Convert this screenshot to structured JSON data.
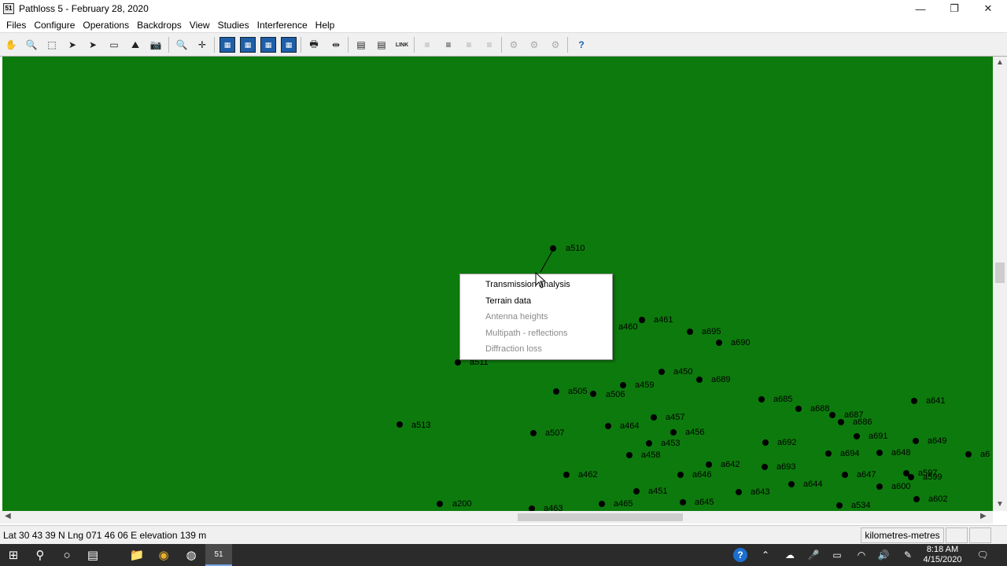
{
  "window": {
    "title": "Pathloss 5 - February 28, 2020",
    "app_icon_text": "51",
    "minimize": "—",
    "restore": "❐",
    "close": "✕"
  },
  "menu": [
    "Files",
    "Configure",
    "Operations",
    "Backdrops",
    "View",
    "Studies",
    "Interference",
    "Help"
  ],
  "toolbar": {
    "pan": "✋",
    "zoom": "🔍",
    "select_area": "⬚",
    "pointer": "➤",
    "pointer_alt": "➤",
    "ruler": "▭",
    "profile": "⛰",
    "camera": "📷",
    "zoom_in": "🔍",
    "fit": "✛",
    "terrain": "▦",
    "clutter": "▦",
    "contour": "▦",
    "bars": "▦",
    "print": "🖶",
    "measure": "⇹",
    "site": "▤",
    "table": "▤",
    "link": "LINK",
    "help": "?"
  },
  "sites": [
    {
      "id": "a510",
      "label": "a510"
    },
    {
      "id": "a460",
      "label": "a460"
    },
    {
      "id": "a461",
      "label": "a461"
    },
    {
      "id": "a695",
      "label": "a695"
    },
    {
      "id": "a690",
      "label": "a690"
    },
    {
      "id": "a511",
      "label": "a511"
    },
    {
      "id": "a450",
      "label": "a450"
    },
    {
      "id": "a689",
      "label": "a689"
    },
    {
      "id": "a459",
      "label": "a459"
    },
    {
      "id": "a505",
      "label": "a505"
    },
    {
      "id": "a506",
      "label": "a506"
    },
    {
      "id": "a685",
      "label": "a685"
    },
    {
      "id": "a641",
      "label": "a641"
    },
    {
      "id": "a688",
      "label": "a688"
    },
    {
      "id": "a687",
      "label": "a687"
    },
    {
      "id": "a686",
      "label": "a686"
    },
    {
      "id": "a457",
      "label": "a457"
    },
    {
      "id": "a513",
      "label": "a513"
    },
    {
      "id": "a464",
      "label": "a464"
    },
    {
      "id": "a456",
      "label": "a456"
    },
    {
      "id": "a507",
      "label": "a507"
    },
    {
      "id": "a691",
      "label": "a691"
    },
    {
      "id": "a453",
      "label": "a453"
    },
    {
      "id": "a692",
      "label": "a692"
    },
    {
      "id": "a649",
      "label": "a649"
    },
    {
      "id": "a458",
      "label": "a458"
    },
    {
      "id": "a694",
      "label": "a694"
    },
    {
      "id": "a648",
      "label": "a648"
    },
    {
      "id": "a642",
      "label": "a642"
    },
    {
      "id": "a693",
      "label": "a693"
    },
    {
      "id": "a462",
      "label": "a462"
    },
    {
      "id": "a646",
      "label": "a646"
    },
    {
      "id": "a647",
      "label": "a647"
    },
    {
      "id": "a644",
      "label": "a644"
    },
    {
      "id": "a451",
      "label": "a451"
    },
    {
      "id": "a643",
      "label": "a643"
    },
    {
      "id": "a600",
      "label": "a600"
    },
    {
      "id": "a200",
      "label": "a200"
    },
    {
      "id": "a645",
      "label": "a645"
    },
    {
      "id": "a465",
      "label": "a465"
    },
    {
      "id": "a534",
      "label": "a534"
    },
    {
      "id": "a602",
      "label": "a602"
    },
    {
      "id": "a463",
      "label": "a463"
    },
    {
      "id": "a597",
      "label": "a597"
    },
    {
      "id": "a599",
      "label": "a599"
    },
    {
      "id": "a6",
      "label": "a6"
    }
  ],
  "context_menu": [
    {
      "label": "Transmission analysis",
      "enabled": true
    },
    {
      "label": "Terrain data",
      "enabled": true
    },
    {
      "label": "Antenna heights",
      "enabled": false
    },
    {
      "label": "Multipath - reflections",
      "enabled": false
    },
    {
      "label": "Diffraction loss",
      "enabled": false
    }
  ],
  "status": {
    "coords": "Lat 30 43 39 N  Lng 071 46 06 E  elevation 139 m",
    "units": "kilometres-metres"
  },
  "taskbar": {
    "start": "⊞",
    "search": "⚲",
    "cortana": "○",
    "task_view": "▤",
    "explorer": "📁",
    "chrome": "◉",
    "app3": "◍",
    "pathloss": "51",
    "help": "?",
    "tray_up": "⌃",
    "onedrive": "☁",
    "mic": "🎤",
    "battery": "▭",
    "wifi": "◠",
    "volume": "🔊",
    "pen": "✎",
    "notifications": "🗨",
    "time": "8:18 AM",
    "date": "4/15/2020"
  },
  "colors": {
    "map_background": "#0d7a0d",
    "site_marker": "#000000"
  }
}
